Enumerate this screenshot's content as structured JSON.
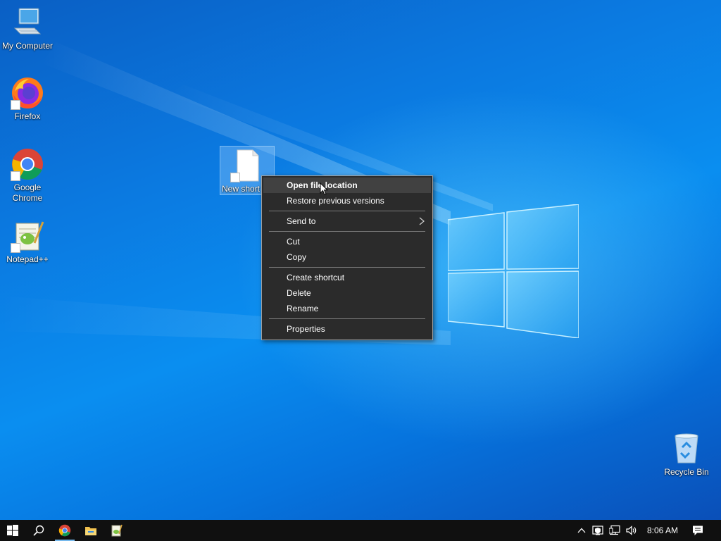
{
  "desktop": {
    "icons": [
      {
        "name": "my-computer",
        "label": "My Computer"
      },
      {
        "name": "firefox",
        "label": "Firefox"
      },
      {
        "name": "google-chrome",
        "label": "Google Chrome"
      },
      {
        "name": "notepad-plus-plus",
        "label": "Notepad++"
      },
      {
        "name": "new-shortcut",
        "label": "New short"
      },
      {
        "name": "recycle-bin",
        "label": "Recycle Bin"
      }
    ]
  },
  "context_menu": {
    "open_file_location": "Open file location",
    "restore_previous_versions": "Restore previous versions",
    "send_to": "Send to",
    "cut": "Cut",
    "copy": "Copy",
    "create_shortcut": "Create shortcut",
    "delete": "Delete",
    "rename": "Rename",
    "properties": "Properties"
  },
  "taskbar": {
    "clock": "8:06 AM",
    "pinned": [
      "start-icon",
      "search-icon",
      "chrome-icon",
      "file-explorer-icon",
      "notepad-icon"
    ],
    "tray": [
      "chevron-up-icon",
      "security-icon",
      "network-icon",
      "volume-icon",
      "notification-icon"
    ]
  },
  "colors": {
    "menu_bg": "#2b2b2b",
    "menu_highlight": "#414141",
    "taskbar_bg": "#101010",
    "desktop_blue": "#0a8ef0"
  }
}
